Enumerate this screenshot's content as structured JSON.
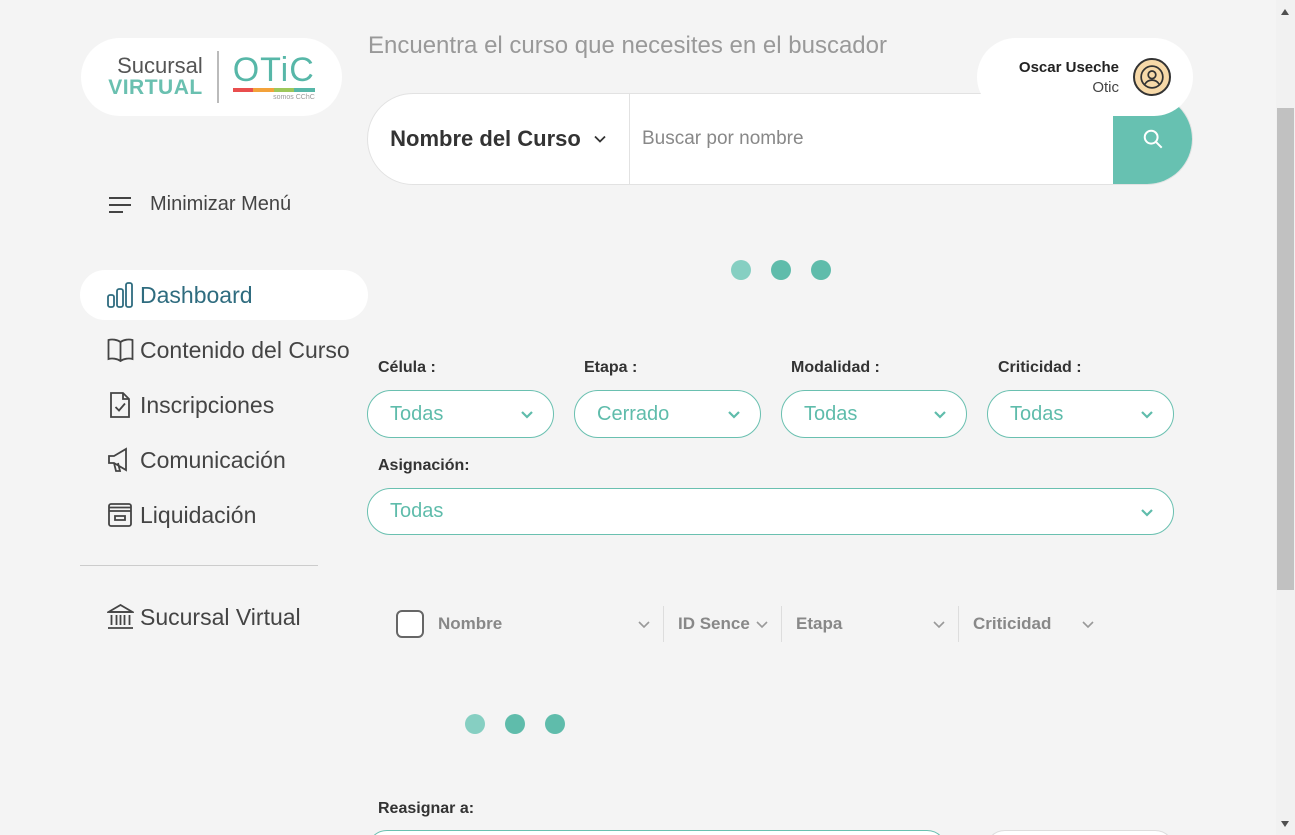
{
  "logo": {
    "line1": "Sucursal",
    "line2": "VIRTUAL",
    "brand": "OTiC",
    "tagline": "somos CChC",
    "colors": [
      "#e94e4e",
      "#f3a23a",
      "#9dc75b",
      "#57b7a8"
    ]
  },
  "header": {
    "title": "Encuentra el curso que necesites en el buscador"
  },
  "user": {
    "name": "Oscar Useche",
    "org": "Otic",
    "icon": "user-circle-icon"
  },
  "search": {
    "type_label": "Nombre del Curso",
    "placeholder": "Buscar por nombre",
    "value": "",
    "button_icon": "search-icon"
  },
  "sidebar": {
    "toggle_label": "Minimizar Menú",
    "items": [
      {
        "label": "Dashboard",
        "icon": "bar-chart-icon",
        "active": true
      },
      {
        "label": "Contenido del Curso",
        "icon": "book-icon",
        "active": false
      },
      {
        "label": "Inscripciones",
        "icon": "document-check-icon",
        "active": false
      },
      {
        "label": "Comunicación",
        "icon": "megaphone-icon",
        "active": false
      },
      {
        "label": "Liquidación",
        "icon": "archive-icon",
        "active": false
      }
    ],
    "footer_item": {
      "label": "Sucursal Virtual",
      "icon": "bank-icon"
    }
  },
  "filters": {
    "celula": {
      "label": "Célula :",
      "value": "Todas"
    },
    "etapa": {
      "label": "Etapa :",
      "value": "Cerrado"
    },
    "modalidad": {
      "label": "Modalidad :",
      "value": "Todas"
    },
    "criticidad": {
      "label": "Criticidad :",
      "value": "Todas"
    },
    "asignacion": {
      "label": "Asignación:",
      "value": "Todas"
    }
  },
  "table": {
    "columns": [
      "Nombre",
      "ID Sence",
      "Etapa",
      "Criticidad"
    ]
  },
  "reasignar": {
    "label": "Reasignar a:"
  },
  "theme": {
    "accent": "#67c1b1",
    "active_text": "#2f6c7f"
  }
}
